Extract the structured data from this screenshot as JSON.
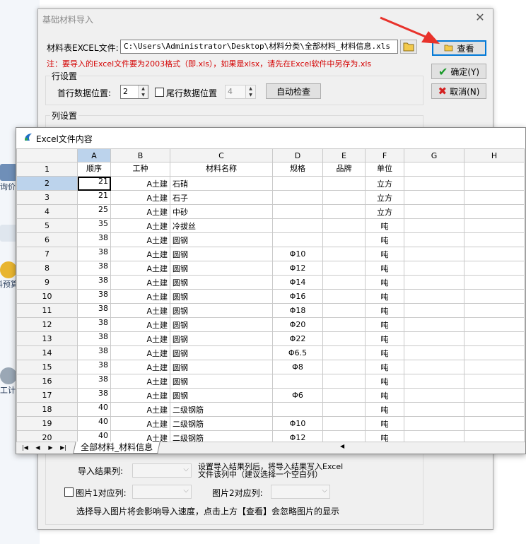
{
  "background_app": {
    "items": [
      "询价单",
      "材料预算",
      "工计划"
    ]
  },
  "dialog": {
    "title": "基础材料导入",
    "file_label": "材料表EXCEL文件:",
    "file_path": "C:\\Users\\Administrator\\Desktop\\材料分类\\全部材料_材料信息.xls",
    "view_button": "查看",
    "ok_button": "确定(Y)",
    "cancel_button": "取消(N)",
    "note": "注：要导入的Excel文件要为2003格式（即.xls），如果是xlsx，请先在Excel软件中另存为.xls",
    "row_group": "行设置",
    "first_row_label": "首行数据位置:",
    "first_row_value": "2",
    "last_row_label": "尾行数据位置",
    "last_row_value": "4",
    "auto_check_button": "自动检查",
    "col_group": "列设置",
    "import_result_label": "导入结果列:",
    "import_result_hint_1": "设置导入结果列后，将导入结果写入Excel",
    "import_result_hint_2": "文件该列中（建议选择一个空白列）",
    "image1_label": "图片1对应列:",
    "image2_label": "图片2对应列:",
    "footer_note": "选择导入图片将会影响导入速度，点击上方【查看】会忽略图片的显示"
  },
  "excel": {
    "title": "Excel文件内容",
    "columns": [
      "A",
      "B",
      "C",
      "D",
      "E",
      "F",
      "G",
      "H"
    ],
    "header_row": [
      "顺序",
      "工种",
      "材料名称",
      "规格",
      "品牌",
      "单位"
    ],
    "rows": [
      [
        "21",
        "A土建",
        "石硝",
        "",
        "",
        "立方"
      ],
      [
        "21",
        "A土建",
        "石子",
        "",
        "",
        "立方"
      ],
      [
        "25",
        "A土建",
        "中砂",
        "",
        "",
        "立方"
      ],
      [
        "35",
        "A土建",
        "冷拔丝",
        "",
        "",
        "吨"
      ],
      [
        "38",
        "A土建",
        "圆钢",
        "",
        "",
        "吨"
      ],
      [
        "38",
        "A土建",
        "圆钢",
        "Φ10",
        "",
        "吨"
      ],
      [
        "38",
        "A土建",
        "圆钢",
        "Φ12",
        "",
        "吨"
      ],
      [
        "38",
        "A土建",
        "圆钢",
        "Φ14",
        "",
        "吨"
      ],
      [
        "38",
        "A土建",
        "圆钢",
        "Φ16",
        "",
        "吨"
      ],
      [
        "38",
        "A土建",
        "圆钢",
        "Φ18",
        "",
        "吨"
      ],
      [
        "38",
        "A土建",
        "圆钢",
        "Φ20",
        "",
        "吨"
      ],
      [
        "38",
        "A土建",
        "圆钢",
        "Φ22",
        "",
        "吨"
      ],
      [
        "38",
        "A土建",
        "圆钢",
        "Φ6.5",
        "",
        "吨"
      ],
      [
        "38",
        "A土建",
        "圆钢",
        "Φ8",
        "",
        "吨"
      ],
      [
        "38",
        "A土建",
        "圆钢",
        "",
        "",
        "吨"
      ],
      [
        "38",
        "A土建",
        "圆钢",
        "Φ6",
        "",
        "吨"
      ],
      [
        "40",
        "A土建",
        "二级钢筋",
        "",
        "",
        "吨"
      ],
      [
        "40",
        "A土建",
        "二级钢筋",
        "Φ10",
        "",
        "吨"
      ],
      [
        "40",
        "A土建",
        "二级钢筋",
        "Φ12",
        "",
        "吨"
      ]
    ],
    "sheet_tab": "全部材料_材料信息"
  },
  "colors": {
    "note_red": "#d40000",
    "selection_blue": "#bcd3ec",
    "arrow_red": "#e8322b"
  }
}
